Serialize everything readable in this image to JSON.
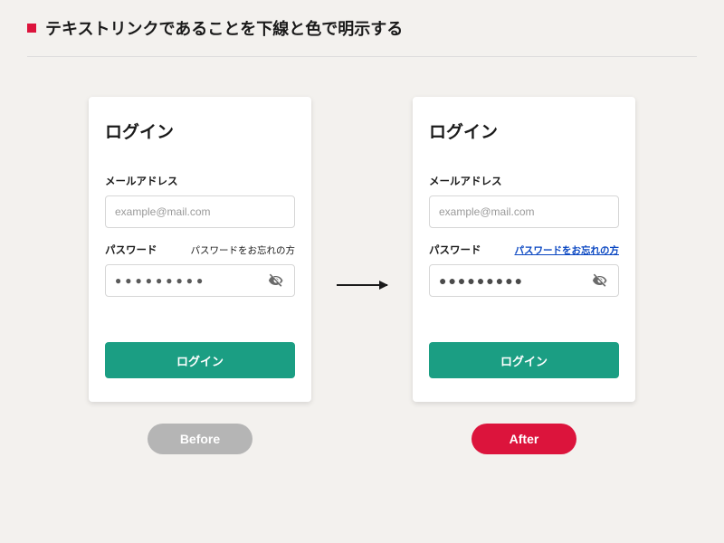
{
  "header": {
    "title": "テキストリンクであることを下線と色で明示する"
  },
  "badges": {
    "before": "Before",
    "after": "After"
  },
  "login": {
    "title": "ログイン",
    "email_label": "メールアドレス",
    "email_placeholder": "example@mail.com",
    "password_label": "パスワード",
    "forgot": "パスワードをお忘れの方",
    "password_mask": "●●●●●●●●●",
    "submit": "ログイン"
  }
}
